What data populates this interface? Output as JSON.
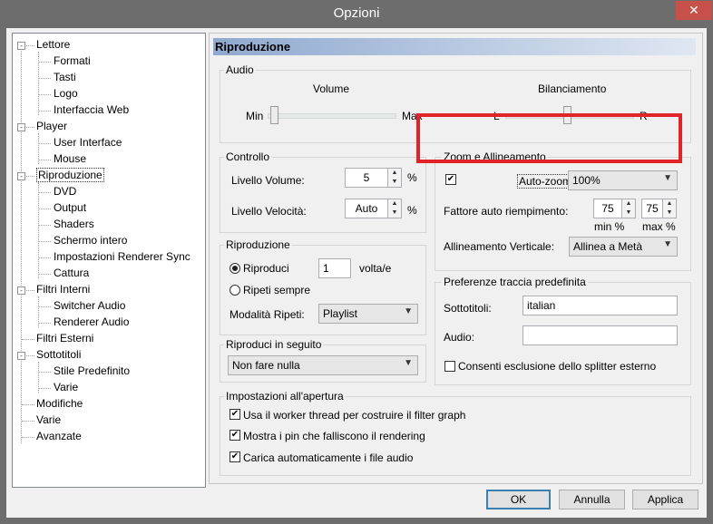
{
  "window": {
    "title": "Opzioni",
    "close_symbol": "✕"
  },
  "tree": {
    "items": [
      {
        "label": "Lettore",
        "expander": "-"
      },
      {
        "label": "Formati"
      },
      {
        "label": "Tasti"
      },
      {
        "label": "Logo"
      },
      {
        "label": "Interfaccia Web"
      },
      {
        "label": "Player",
        "expander": "-"
      },
      {
        "label": "User Interface"
      },
      {
        "label": "Mouse"
      },
      {
        "label": "Riproduzione",
        "expander": "-"
      },
      {
        "label": "DVD"
      },
      {
        "label": "Output"
      },
      {
        "label": "Shaders"
      },
      {
        "label": "Schermo intero"
      },
      {
        "label": "Impostazioni Renderer Sync"
      },
      {
        "label": "Cattura"
      },
      {
        "label": "Filtri Interni",
        "expander": "-"
      },
      {
        "label": "Switcher Audio"
      },
      {
        "label": "Renderer Audio"
      },
      {
        "label": "Filtri Esterni"
      },
      {
        "label": "Sottotitoli",
        "expander": "-"
      },
      {
        "label": "Stile Predefinito"
      },
      {
        "label": "Varie"
      },
      {
        "label": "Modifiche"
      },
      {
        "label": "Varie"
      },
      {
        "label": "Avanzate"
      }
    ]
  },
  "page": {
    "header": "Riproduzione",
    "audio": {
      "group": "Audio",
      "volume_label": "Volume",
      "volume_min": "Min",
      "volume_max": "Max",
      "balance_label": "Bilanciamento",
      "balance_left": "L",
      "balance_right": "R"
    },
    "controllo": {
      "group": "Controllo",
      "volume_level_label": "Livello Volume:",
      "volume_level_value": "5",
      "volume_unit": "%",
      "speed_level_label": "Livello Velocità:",
      "speed_level_value": "Auto",
      "speed_unit": "%"
    },
    "zoom": {
      "group": "Zoom e Allineamento",
      "auto_zoom_label": "Auto-zoom:",
      "auto_zoom_value": "100%",
      "auto_zoom_checked": "✔",
      "fill_factor_label": "Fattore auto riempimento:",
      "min_value": "75",
      "max_value": "75",
      "min_label": "min %",
      "max_label": "max %",
      "align_label": "Allineamento Verticale:",
      "align_value": "Allinea a Metà"
    },
    "riproduzione": {
      "group": "Riproduzione",
      "play_label": "Riproduci",
      "play_count": "1",
      "times_label": "volta/e",
      "repeat_label": "Ripeti sempre",
      "repeat_mode_label": "Modalità Ripeti:",
      "repeat_mode_value": "Playlist"
    },
    "sequenza": {
      "group": "Riproduci in seguito",
      "value": "Non fare nulla"
    },
    "tracce": {
      "group": "Preferenze traccia predefinita",
      "subs_label": "Sottotitoli:",
      "subs_value": "italian",
      "audio_label": "Audio:",
      "audio_value": "",
      "splitter_label": "Consenti esclusione dello splitter esterno"
    },
    "apertura": {
      "group": "Impostazioni all'apertura",
      "opt1": "Usa il worker thread per costruire il filter graph",
      "opt2": "Mostra i pin che falliscono il rendering",
      "opt3": "Carica automaticamente i file audio",
      "check": "✔"
    }
  },
  "buttons": {
    "ok": "OK",
    "cancel": "Annulla",
    "apply": "Applica"
  },
  "colors": {
    "highlight": "#e0242a",
    "header_gradient_start": "#8fa9cf"
  }
}
